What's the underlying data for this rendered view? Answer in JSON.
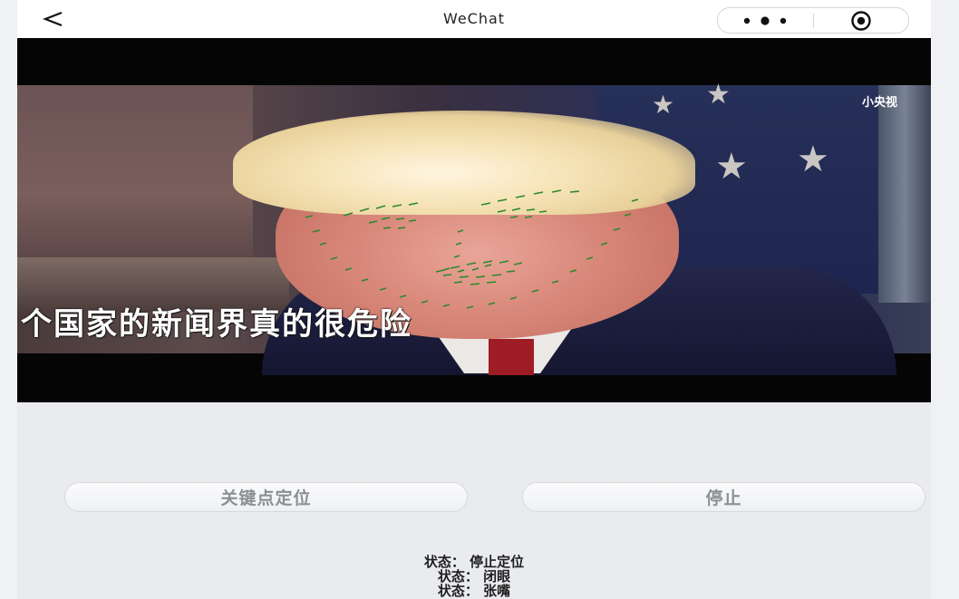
{
  "navbar": {
    "title": "WeChat",
    "back_icon": "chevron-left-icon",
    "more_icon": "more-dots-icon",
    "close_icon": "target-circle-icon"
  },
  "camera": {
    "subtitle": "个国家的新闻界真的很危险",
    "watermark": "小央视",
    "landmark_color": "#2a8a2a"
  },
  "buttons": {
    "locate_label": "关键点定位",
    "stop_label": "停止"
  },
  "status": {
    "line1": "状态： 停止定位",
    "line2": "状态： 闭眼",
    "line3": "状态： 张嘴"
  },
  "colors": {
    "background": "#e9ebee",
    "button_text": "#8c8f93"
  }
}
